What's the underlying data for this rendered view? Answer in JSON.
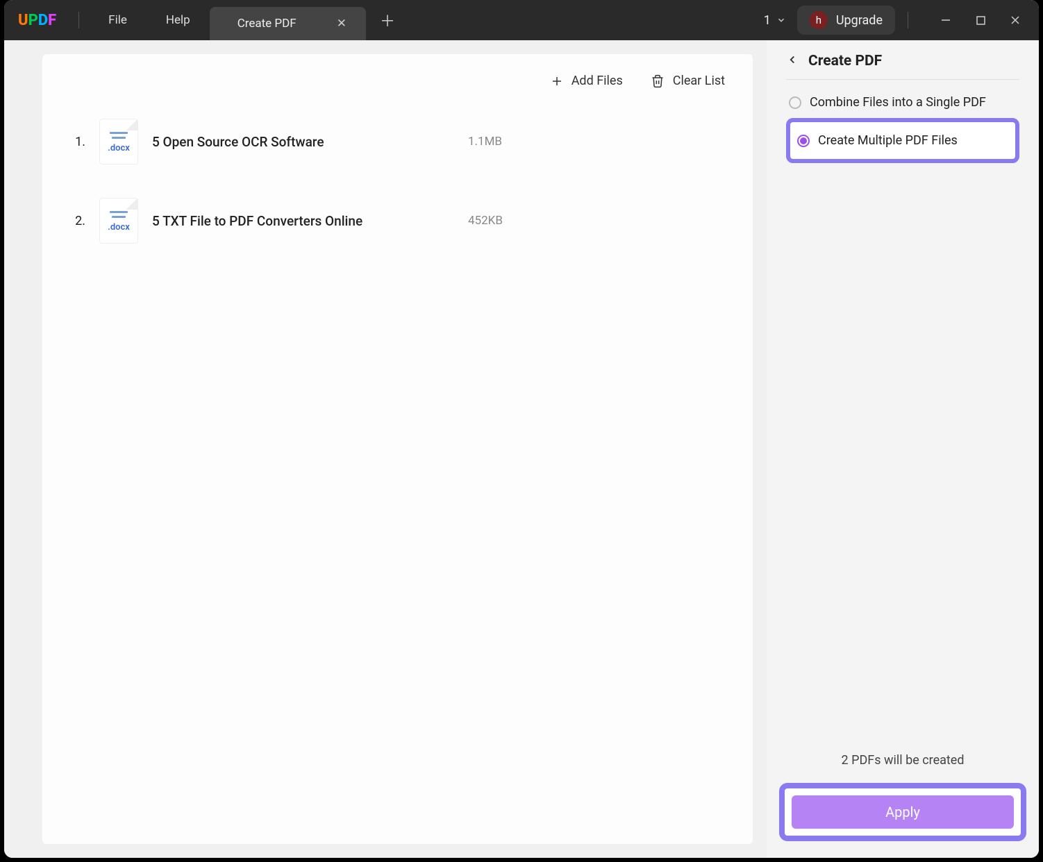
{
  "titleBar": {
    "menus": {
      "file": "File",
      "help": "Help"
    },
    "tab": {
      "title": "Create PDF"
    },
    "tabCount": "1",
    "upgrade": {
      "avatarInitial": "h",
      "label": "Upgrade"
    }
  },
  "toolbar": {
    "addFiles": "Add Files",
    "clearList": "Clear List"
  },
  "files": [
    {
      "num": "1.",
      "name": "5 Open Source OCR Software",
      "ext": ".docx",
      "size": "1.1MB"
    },
    {
      "num": "2.",
      "name": "5 TXT File to PDF Converters Online",
      "ext": ".docx",
      "size": "452KB"
    }
  ],
  "sidePanel": {
    "title": "Create PDF",
    "options": {
      "combine": "Combine Files into a Single PDF",
      "multiple": "Create Multiple PDF Files"
    },
    "status": "2 PDFs will be created",
    "apply": "Apply"
  }
}
